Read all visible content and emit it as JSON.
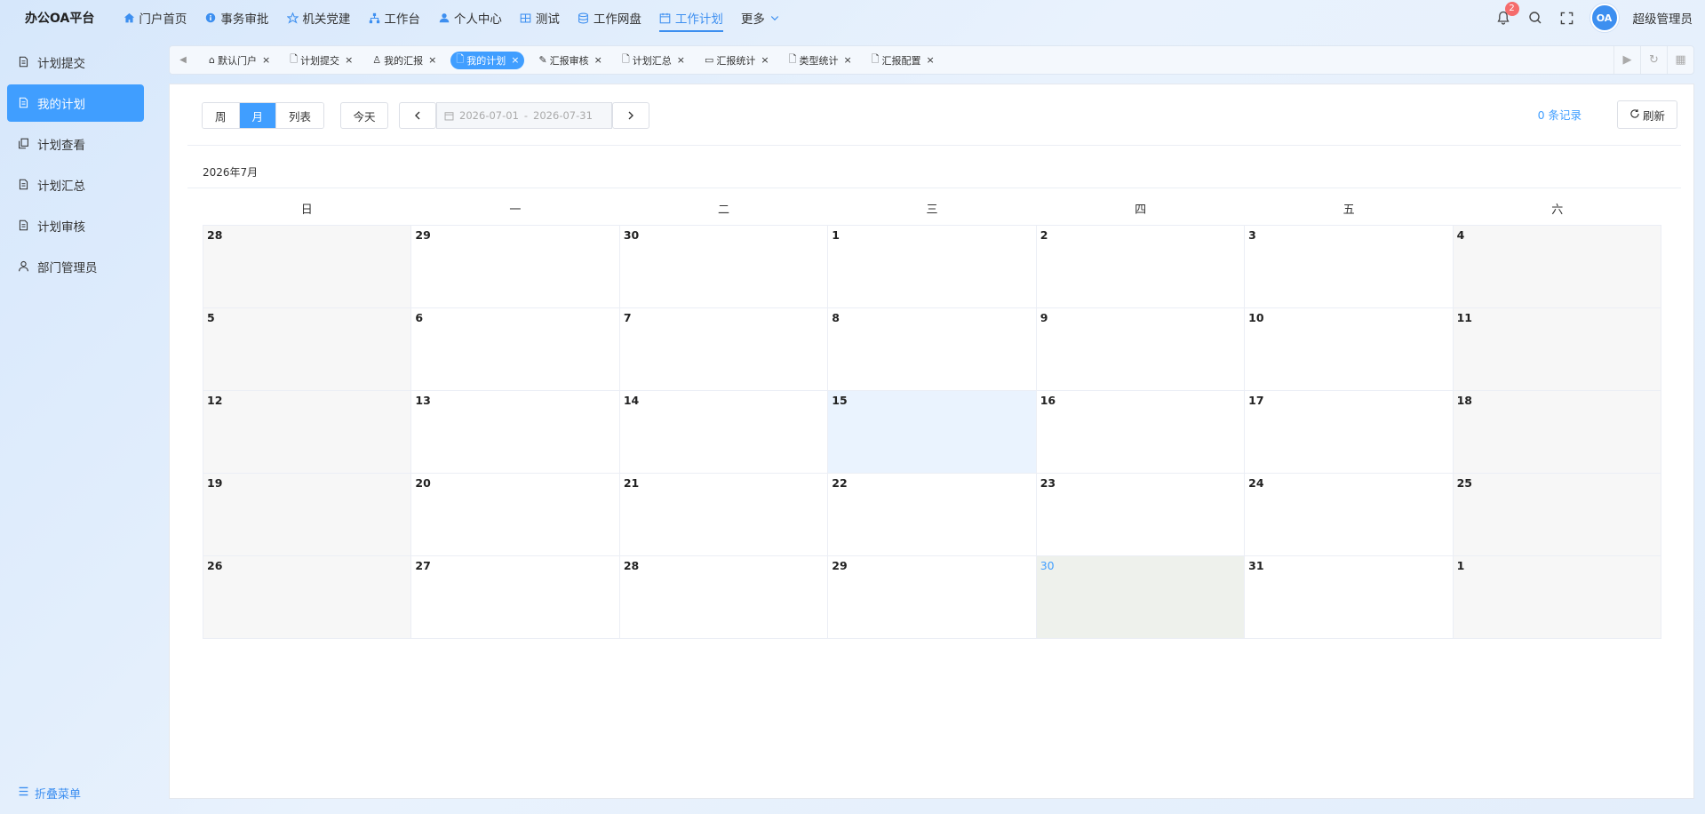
{
  "app": {
    "title": "办公OA平台"
  },
  "nav": {
    "items": [
      {
        "label": "门户首页",
        "icon": "home-icon"
      },
      {
        "label": "事务审批",
        "icon": "info-icon"
      },
      {
        "label": "机关党建",
        "icon": "star-icon"
      },
      {
        "label": "工作台",
        "icon": "org-icon"
      },
      {
        "label": "个人中心",
        "icon": "user-icon"
      },
      {
        "label": "测试",
        "icon": "grid-icon"
      },
      {
        "label": "工作网盘",
        "icon": "database-icon"
      },
      {
        "label": "工作计划",
        "icon": "calendar-icon",
        "active": true
      },
      {
        "label": "更多",
        "icon": "chevron-down-icon"
      }
    ]
  },
  "header": {
    "notification_count": "2",
    "avatar_text": "OA",
    "username": "超级管理员"
  },
  "sidebar": {
    "items": [
      {
        "label": "计划提交"
      },
      {
        "label": "我的计划",
        "active": true
      },
      {
        "label": "计划查看"
      },
      {
        "label": "计划汇总"
      },
      {
        "label": "计划审核"
      },
      {
        "label": "部门管理员"
      }
    ],
    "collapse_label": "折叠菜单"
  },
  "tabs": [
    {
      "label": "默认门户"
    },
    {
      "label": "计划提交"
    },
    {
      "label": "我的汇报"
    },
    {
      "label": "我的计划",
      "active": true
    },
    {
      "label": "汇报审核"
    },
    {
      "label": "计划汇总"
    },
    {
      "label": "汇报统计"
    },
    {
      "label": "类型统计"
    },
    {
      "label": "汇报配置"
    }
  ],
  "toolbar": {
    "views": [
      "周",
      "月",
      "列表"
    ],
    "active_view": "月",
    "today_label": "今天",
    "date_start": "2026-07-01",
    "date_separator": "-",
    "date_end": "2026-07-31",
    "records_label": "0 条记录",
    "refresh_label": "刷新"
  },
  "calendar": {
    "month_title": "2026年7月",
    "weekdays": [
      "日",
      "一",
      "二",
      "三",
      "四",
      "五",
      "六"
    ],
    "days": [
      "28",
      "29",
      "30",
      "1",
      "2",
      "3",
      "4",
      "5",
      "6",
      "7",
      "8",
      "9",
      "10",
      "11",
      "12",
      "13",
      "14",
      "15",
      "16",
      "17",
      "18",
      "19",
      "20",
      "21",
      "22",
      "23",
      "24",
      "25",
      "26",
      "27",
      "28",
      "29",
      "30",
      "31",
      "1"
    ],
    "highlighted_day": "15",
    "today_day": "30"
  },
  "colors": {
    "accent": "#409eff",
    "badge": "#f56c6c",
    "today_bg": "#eef1ec",
    "highlight_bg": "#eaf3fe",
    "weekend_bg": "#f7f7f7"
  }
}
